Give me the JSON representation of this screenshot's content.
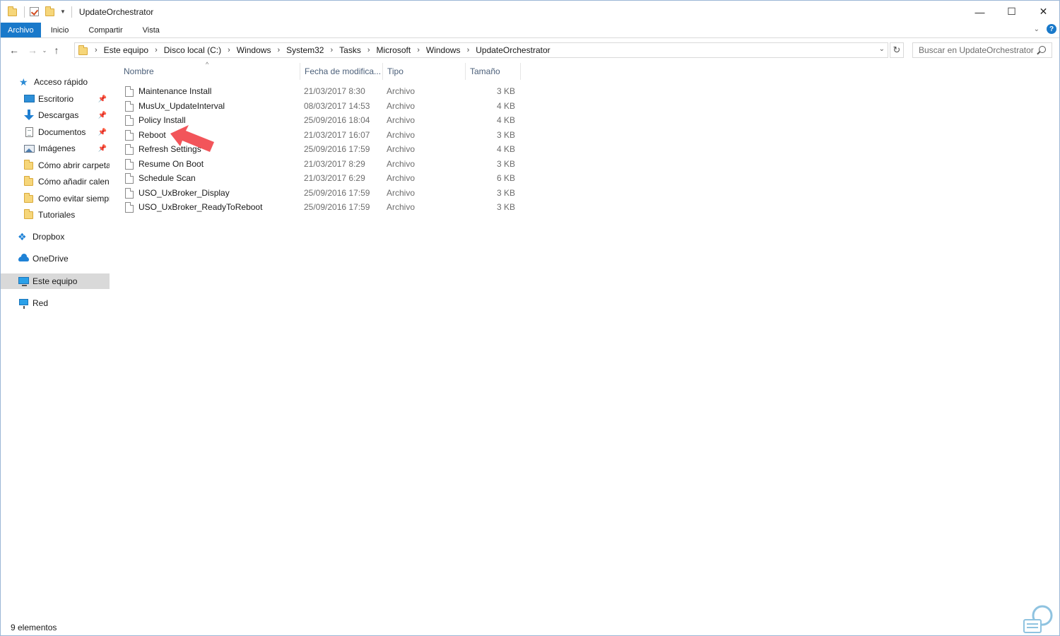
{
  "window": {
    "title": "UpdateOrchestrator",
    "controls": [
      "—",
      "☐",
      "✕"
    ]
  },
  "ribbon": {
    "tabs": [
      "Archivo",
      "Inicio",
      "Compartir",
      "Vista"
    ],
    "help": "?"
  },
  "address": {
    "crumbs": [
      "Este equipo",
      "Disco local (C:)",
      "Windows",
      "System32",
      "Tasks",
      "Microsoft",
      "Windows",
      "UpdateOrchestrator"
    ]
  },
  "search": {
    "placeholder": "Buscar en UpdateOrchestrator"
  },
  "sidebar": {
    "items": [
      {
        "label": "Acceso rápido",
        "icon": "star-icon"
      },
      {
        "label": "Escritorio",
        "icon": "desktop-icon",
        "pinned": true
      },
      {
        "label": "Descargas",
        "icon": "download-icon",
        "pinned": true
      },
      {
        "label": "Documentos",
        "icon": "documents-icon",
        "pinned": true
      },
      {
        "label": "Imágenes",
        "icon": "pictures-icon",
        "pinned": true
      },
      {
        "label": "Cómo abrir carpeta",
        "icon": "folder-icon"
      },
      {
        "label": "Cómo añadir calenc",
        "icon": "folder-icon"
      },
      {
        "label": "Como evitar siempr",
        "icon": "folder-icon"
      },
      {
        "label": "Tutoriales",
        "icon": "folder-icon"
      },
      {
        "label": "Dropbox",
        "icon": "dropbox-icon"
      },
      {
        "label": "OneDrive",
        "icon": "onedrive-icon"
      },
      {
        "label": "Este equipo",
        "icon": "this-pc-icon",
        "selected": true
      },
      {
        "label": "Red",
        "icon": "network-icon"
      }
    ]
  },
  "table": {
    "columns": [
      "Nombre",
      "Fecha de modifica...",
      "Tipo",
      "Tamaño"
    ],
    "rows": [
      {
        "name": "Maintenance Install",
        "date": "21/03/2017 8:30",
        "type": "Archivo",
        "size": "3 KB"
      },
      {
        "name": "MusUx_UpdateInterval",
        "date": "08/03/2017 14:53",
        "type": "Archivo",
        "size": "4 KB"
      },
      {
        "name": "Policy Install",
        "date": "25/09/2016 18:04",
        "type": "Archivo",
        "size": "4 KB"
      },
      {
        "name": "Reboot",
        "date": "21/03/2017 16:07",
        "type": "Archivo",
        "size": "3 KB"
      },
      {
        "name": "Refresh Settings",
        "date": "25/09/2016 17:59",
        "type": "Archivo",
        "size": "4 KB"
      },
      {
        "name": "Resume On Boot",
        "date": "21/03/2017 8:29",
        "type": "Archivo",
        "size": "3 KB"
      },
      {
        "name": "Schedule Scan",
        "date": "21/03/2017 6:29",
        "type": "Archivo",
        "size": "6 KB"
      },
      {
        "name": "USO_UxBroker_Display",
        "date": "25/09/2016 17:59",
        "type": "Archivo",
        "size": "3 KB"
      },
      {
        "name": "USO_UxBroker_ReadyToReboot",
        "date": "25/09/2016 17:59",
        "type": "Archivo",
        "size": "3 KB"
      }
    ]
  },
  "status": {
    "count": "9 elementos"
  },
  "colors": {
    "accent": "#1979ca",
    "annotation_arrow": "#f2555a",
    "selection": "#d9d9d9"
  }
}
